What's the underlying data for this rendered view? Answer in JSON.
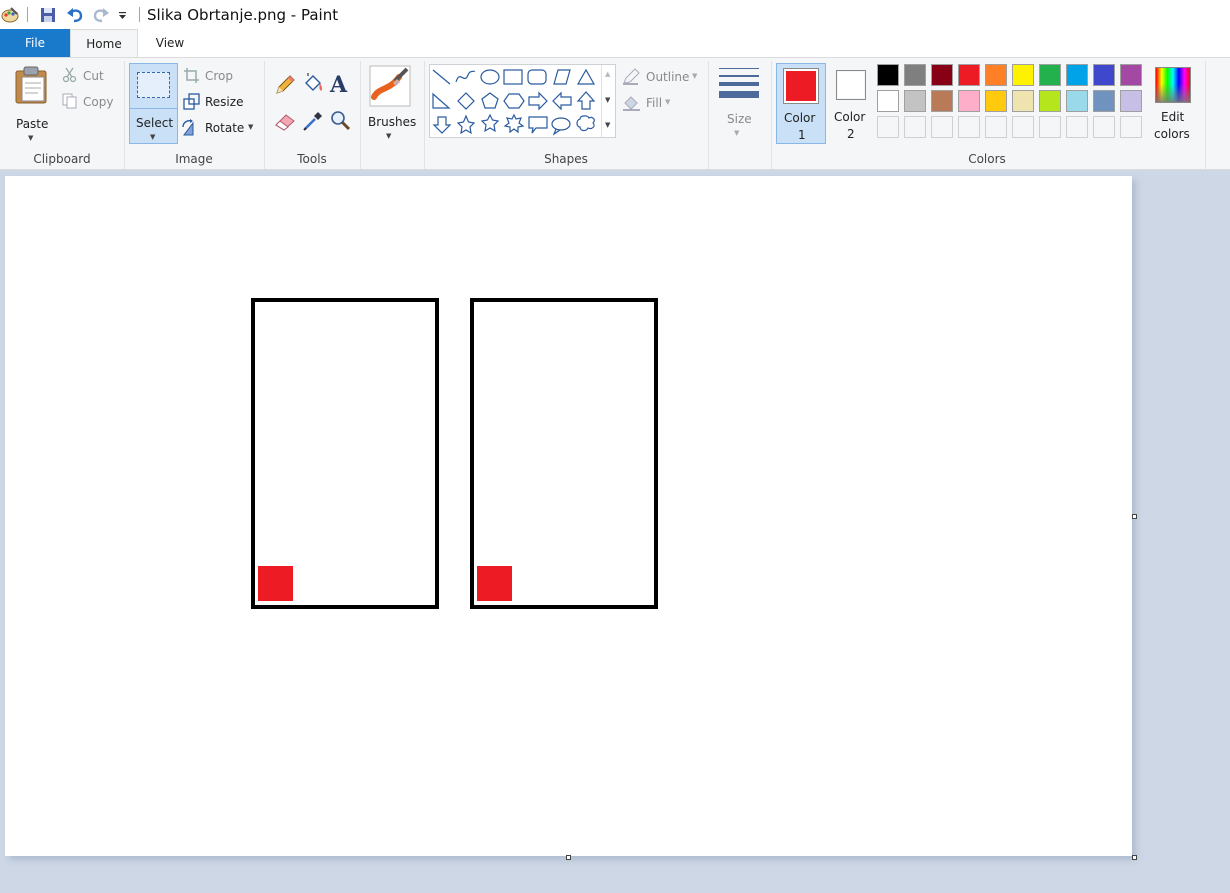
{
  "window": {
    "title": "Slika Obrtanje.png - Paint",
    "quick_access": [
      "paint-app-icon",
      "save-icon",
      "undo-icon",
      "redo-icon",
      "customize-dropdown-icon"
    ]
  },
  "tabs": {
    "file": "File",
    "home": "Home",
    "view": "View",
    "active": "Home"
  },
  "clipboard": {
    "paste": "Paste",
    "cut": "Cut",
    "copy": "Copy",
    "group_label": "Clipboard"
  },
  "image": {
    "select": "Select",
    "crop": "Crop",
    "resize": "Resize",
    "rotate": "Rotate",
    "group_label": "Image"
  },
  "tools": {
    "group_label": "Tools",
    "items": [
      "pencil-icon",
      "fill-bucket-icon",
      "text-icon",
      "eraser-icon",
      "color-picker-icon",
      "magnifier-icon"
    ]
  },
  "brushes": {
    "label": "Brushes"
  },
  "shapes": {
    "outline": "Outline",
    "fill": "Fill",
    "group_label": "Shapes"
  },
  "size": {
    "label": "Size"
  },
  "colors": {
    "color1_line1": "Color",
    "color1_line2": "1",
    "color2_line1": "Color",
    "color2_line2": "2",
    "color1_value": "#ed1c24",
    "color2_value": "#ffffff",
    "edit_line1": "Edit",
    "edit_line2": "colors",
    "group_label": "Colors",
    "palette_row1": [
      "#000000",
      "#7f7f7f",
      "#880015",
      "#ed1c24",
      "#ff7f27",
      "#fff200",
      "#22b14c",
      "#00a2e8",
      "#3f48cc",
      "#a349a4"
    ],
    "palette_row2": [
      "#ffffff",
      "#c3c3c3",
      "#b97a57",
      "#ffaec9",
      "#ffc90e",
      "#efe4b0",
      "#b5e61d",
      "#99d9ea",
      "#7092be",
      "#c8bfe7"
    ]
  },
  "canvas": {
    "frame_border": "#000000",
    "square_color": "#ed1c24"
  }
}
